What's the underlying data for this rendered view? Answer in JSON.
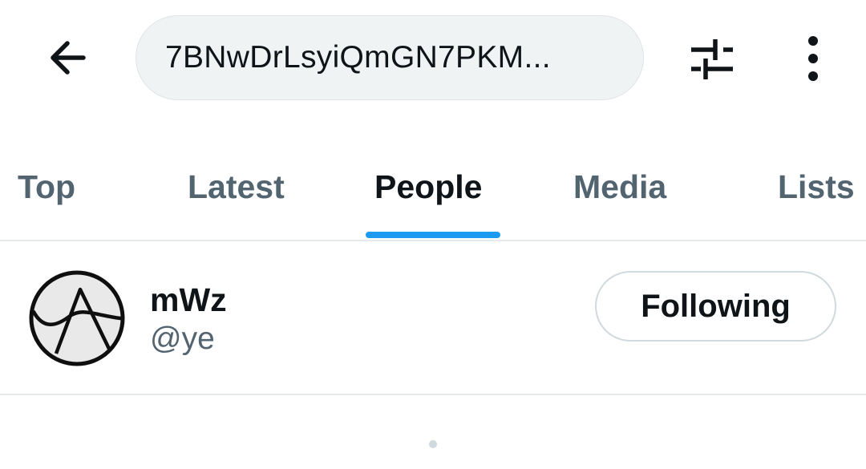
{
  "header": {
    "back_icon": "arrow-left-icon",
    "search_query": "7BNwDrLsyiQmGN7PKM...",
    "filter_icon": "sliders-icon",
    "more_icon": "more-vertical-icon"
  },
  "tabs": [
    {
      "label": "Top",
      "active": false
    },
    {
      "label": "Latest",
      "active": false
    },
    {
      "label": "People",
      "active": true
    },
    {
      "label": "Media",
      "active": false
    },
    {
      "label": "Lists",
      "active": false
    }
  ],
  "results": [
    {
      "display_name": "mWz",
      "handle": "@ye",
      "follow_label": "Following",
      "avatar_icon": "avatar-logo-icon"
    }
  ],
  "colors": {
    "accent": "#1d9bf0",
    "text_primary": "#0f1419",
    "text_secondary": "#536471",
    "search_bg": "#eff3f4",
    "divider": "#e7eaeb"
  }
}
